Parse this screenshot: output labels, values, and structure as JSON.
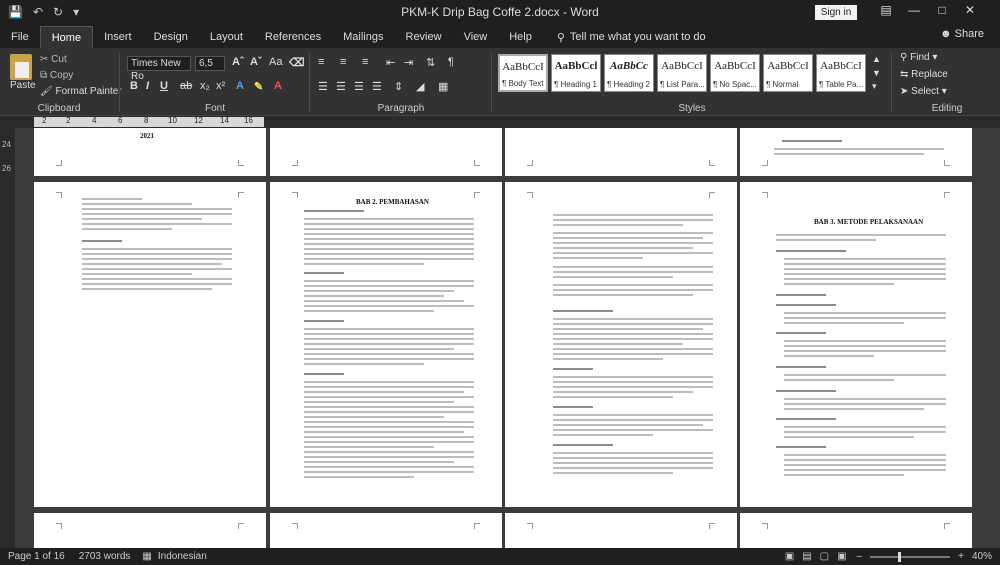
{
  "title_bar": {
    "document_title": "PKM-K Drip Bag Coffe 2.docx  -  Word",
    "sign_in_label": "Sign in"
  },
  "tabs": [
    "File",
    "Home",
    "Insert",
    "Design",
    "Layout",
    "References",
    "Mailings",
    "Review",
    "View",
    "Help"
  ],
  "tell_me": "Tell me what you want to do",
  "share_label": "Share",
  "ribbon": {
    "clipboard": {
      "paste": "Paste",
      "cut": "Cut",
      "copy": "Copy",
      "format_painter": "Format Painter",
      "label": "Clipboard"
    },
    "font": {
      "font_name": "Times New Ro",
      "font_size": "6,5",
      "label": "Font"
    },
    "paragraph": {
      "label": "Paragraph"
    },
    "styles": {
      "label": "Styles",
      "items": [
        {
          "preview": "AaBbCcI",
          "name": "¶ Body Text"
        },
        {
          "preview": "AaBbCcl",
          "name": "¶ Heading 1"
        },
        {
          "preview": "AaBbCc",
          "name": "¶ Heading 2"
        },
        {
          "preview": "AaBbCcI",
          "name": "¶ List Para..."
        },
        {
          "preview": "AaBbCcI",
          "name": "¶ No Spac..."
        },
        {
          "preview": "AaBbCcI",
          "name": "¶ Normal"
        },
        {
          "preview": "AaBbCcI",
          "name": "¶ Table Pa..."
        }
      ]
    },
    "editing": {
      "find": "Find",
      "replace": "Replace",
      "select": "Select",
      "label": "Editing"
    }
  },
  "ruler": {
    "h_ticks": [
      "2",
      "2",
      "4",
      "6",
      "8",
      "10",
      "12",
      "14",
      "16"
    ],
    "v_ticks": [
      "24",
      "26"
    ]
  },
  "pages": {
    "p1_heading": "2021",
    "p6_heading": "BAB 2. PEMBAHASAN",
    "p8_heading": "BAB 3. METODE PELAKSANAAN"
  },
  "status": {
    "page": "Page 1 of 16",
    "words": "2703 words",
    "language": "Indonesian",
    "zoom": "40%"
  },
  "colors": {
    "background": "#1f1f1f",
    "ribbon": "#323232",
    "canvas": "#3c3c3c"
  }
}
